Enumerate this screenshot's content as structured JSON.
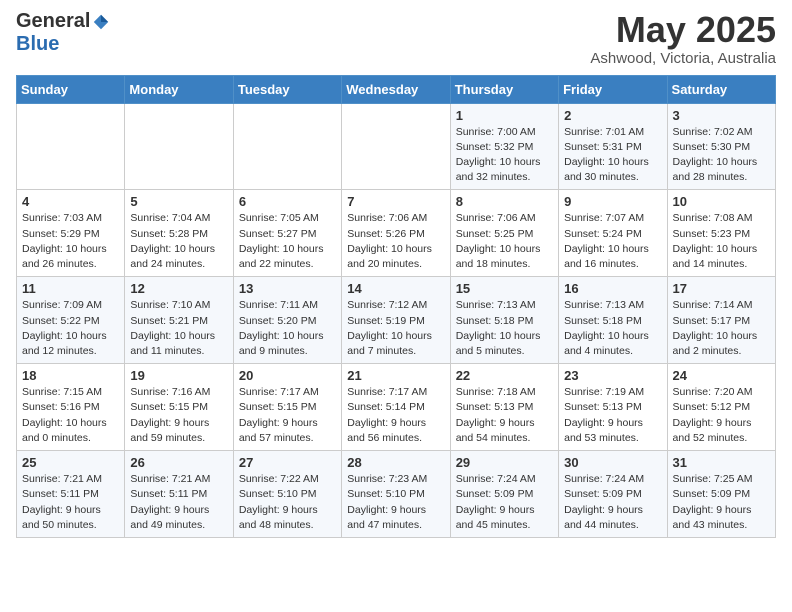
{
  "logo": {
    "general": "General",
    "blue": "Blue"
  },
  "header": {
    "month": "May 2025",
    "location": "Ashwood, Victoria, Australia"
  },
  "weekdays": [
    "Sunday",
    "Monday",
    "Tuesday",
    "Wednesday",
    "Thursday",
    "Friday",
    "Saturday"
  ],
  "weeks": [
    [
      {
        "day": "",
        "info": ""
      },
      {
        "day": "",
        "info": ""
      },
      {
        "day": "",
        "info": ""
      },
      {
        "day": "",
        "info": ""
      },
      {
        "day": "1",
        "info": "Sunrise: 7:00 AM\nSunset: 5:32 PM\nDaylight: 10 hours\nand 32 minutes."
      },
      {
        "day": "2",
        "info": "Sunrise: 7:01 AM\nSunset: 5:31 PM\nDaylight: 10 hours\nand 30 minutes."
      },
      {
        "day": "3",
        "info": "Sunrise: 7:02 AM\nSunset: 5:30 PM\nDaylight: 10 hours\nand 28 minutes."
      }
    ],
    [
      {
        "day": "4",
        "info": "Sunrise: 7:03 AM\nSunset: 5:29 PM\nDaylight: 10 hours\nand 26 minutes."
      },
      {
        "day": "5",
        "info": "Sunrise: 7:04 AM\nSunset: 5:28 PM\nDaylight: 10 hours\nand 24 minutes."
      },
      {
        "day": "6",
        "info": "Sunrise: 7:05 AM\nSunset: 5:27 PM\nDaylight: 10 hours\nand 22 minutes."
      },
      {
        "day": "7",
        "info": "Sunrise: 7:06 AM\nSunset: 5:26 PM\nDaylight: 10 hours\nand 20 minutes."
      },
      {
        "day": "8",
        "info": "Sunrise: 7:06 AM\nSunset: 5:25 PM\nDaylight: 10 hours\nand 18 minutes."
      },
      {
        "day": "9",
        "info": "Sunrise: 7:07 AM\nSunset: 5:24 PM\nDaylight: 10 hours\nand 16 minutes."
      },
      {
        "day": "10",
        "info": "Sunrise: 7:08 AM\nSunset: 5:23 PM\nDaylight: 10 hours\nand 14 minutes."
      }
    ],
    [
      {
        "day": "11",
        "info": "Sunrise: 7:09 AM\nSunset: 5:22 PM\nDaylight: 10 hours\nand 12 minutes."
      },
      {
        "day": "12",
        "info": "Sunrise: 7:10 AM\nSunset: 5:21 PM\nDaylight: 10 hours\nand 11 minutes."
      },
      {
        "day": "13",
        "info": "Sunrise: 7:11 AM\nSunset: 5:20 PM\nDaylight: 10 hours\nand 9 minutes."
      },
      {
        "day": "14",
        "info": "Sunrise: 7:12 AM\nSunset: 5:19 PM\nDaylight: 10 hours\nand 7 minutes."
      },
      {
        "day": "15",
        "info": "Sunrise: 7:13 AM\nSunset: 5:18 PM\nDaylight: 10 hours\nand 5 minutes."
      },
      {
        "day": "16",
        "info": "Sunrise: 7:13 AM\nSunset: 5:18 PM\nDaylight: 10 hours\nand 4 minutes."
      },
      {
        "day": "17",
        "info": "Sunrise: 7:14 AM\nSunset: 5:17 PM\nDaylight: 10 hours\nand 2 minutes."
      }
    ],
    [
      {
        "day": "18",
        "info": "Sunrise: 7:15 AM\nSunset: 5:16 PM\nDaylight: 10 hours\nand 0 minutes."
      },
      {
        "day": "19",
        "info": "Sunrise: 7:16 AM\nSunset: 5:15 PM\nDaylight: 9 hours\nand 59 minutes."
      },
      {
        "day": "20",
        "info": "Sunrise: 7:17 AM\nSunset: 5:15 PM\nDaylight: 9 hours\nand 57 minutes."
      },
      {
        "day": "21",
        "info": "Sunrise: 7:17 AM\nSunset: 5:14 PM\nDaylight: 9 hours\nand 56 minutes."
      },
      {
        "day": "22",
        "info": "Sunrise: 7:18 AM\nSunset: 5:13 PM\nDaylight: 9 hours\nand 54 minutes."
      },
      {
        "day": "23",
        "info": "Sunrise: 7:19 AM\nSunset: 5:13 PM\nDaylight: 9 hours\nand 53 minutes."
      },
      {
        "day": "24",
        "info": "Sunrise: 7:20 AM\nSunset: 5:12 PM\nDaylight: 9 hours\nand 52 minutes."
      }
    ],
    [
      {
        "day": "25",
        "info": "Sunrise: 7:21 AM\nSunset: 5:11 PM\nDaylight: 9 hours\nand 50 minutes."
      },
      {
        "day": "26",
        "info": "Sunrise: 7:21 AM\nSunset: 5:11 PM\nDaylight: 9 hours\nand 49 minutes."
      },
      {
        "day": "27",
        "info": "Sunrise: 7:22 AM\nSunset: 5:10 PM\nDaylight: 9 hours\nand 48 minutes."
      },
      {
        "day": "28",
        "info": "Sunrise: 7:23 AM\nSunset: 5:10 PM\nDaylight: 9 hours\nand 47 minutes."
      },
      {
        "day": "29",
        "info": "Sunrise: 7:24 AM\nSunset: 5:09 PM\nDaylight: 9 hours\nand 45 minutes."
      },
      {
        "day": "30",
        "info": "Sunrise: 7:24 AM\nSunset: 5:09 PM\nDaylight: 9 hours\nand 44 minutes."
      },
      {
        "day": "31",
        "info": "Sunrise: 7:25 AM\nSunset: 5:09 PM\nDaylight: 9 hours\nand 43 minutes."
      }
    ]
  ]
}
